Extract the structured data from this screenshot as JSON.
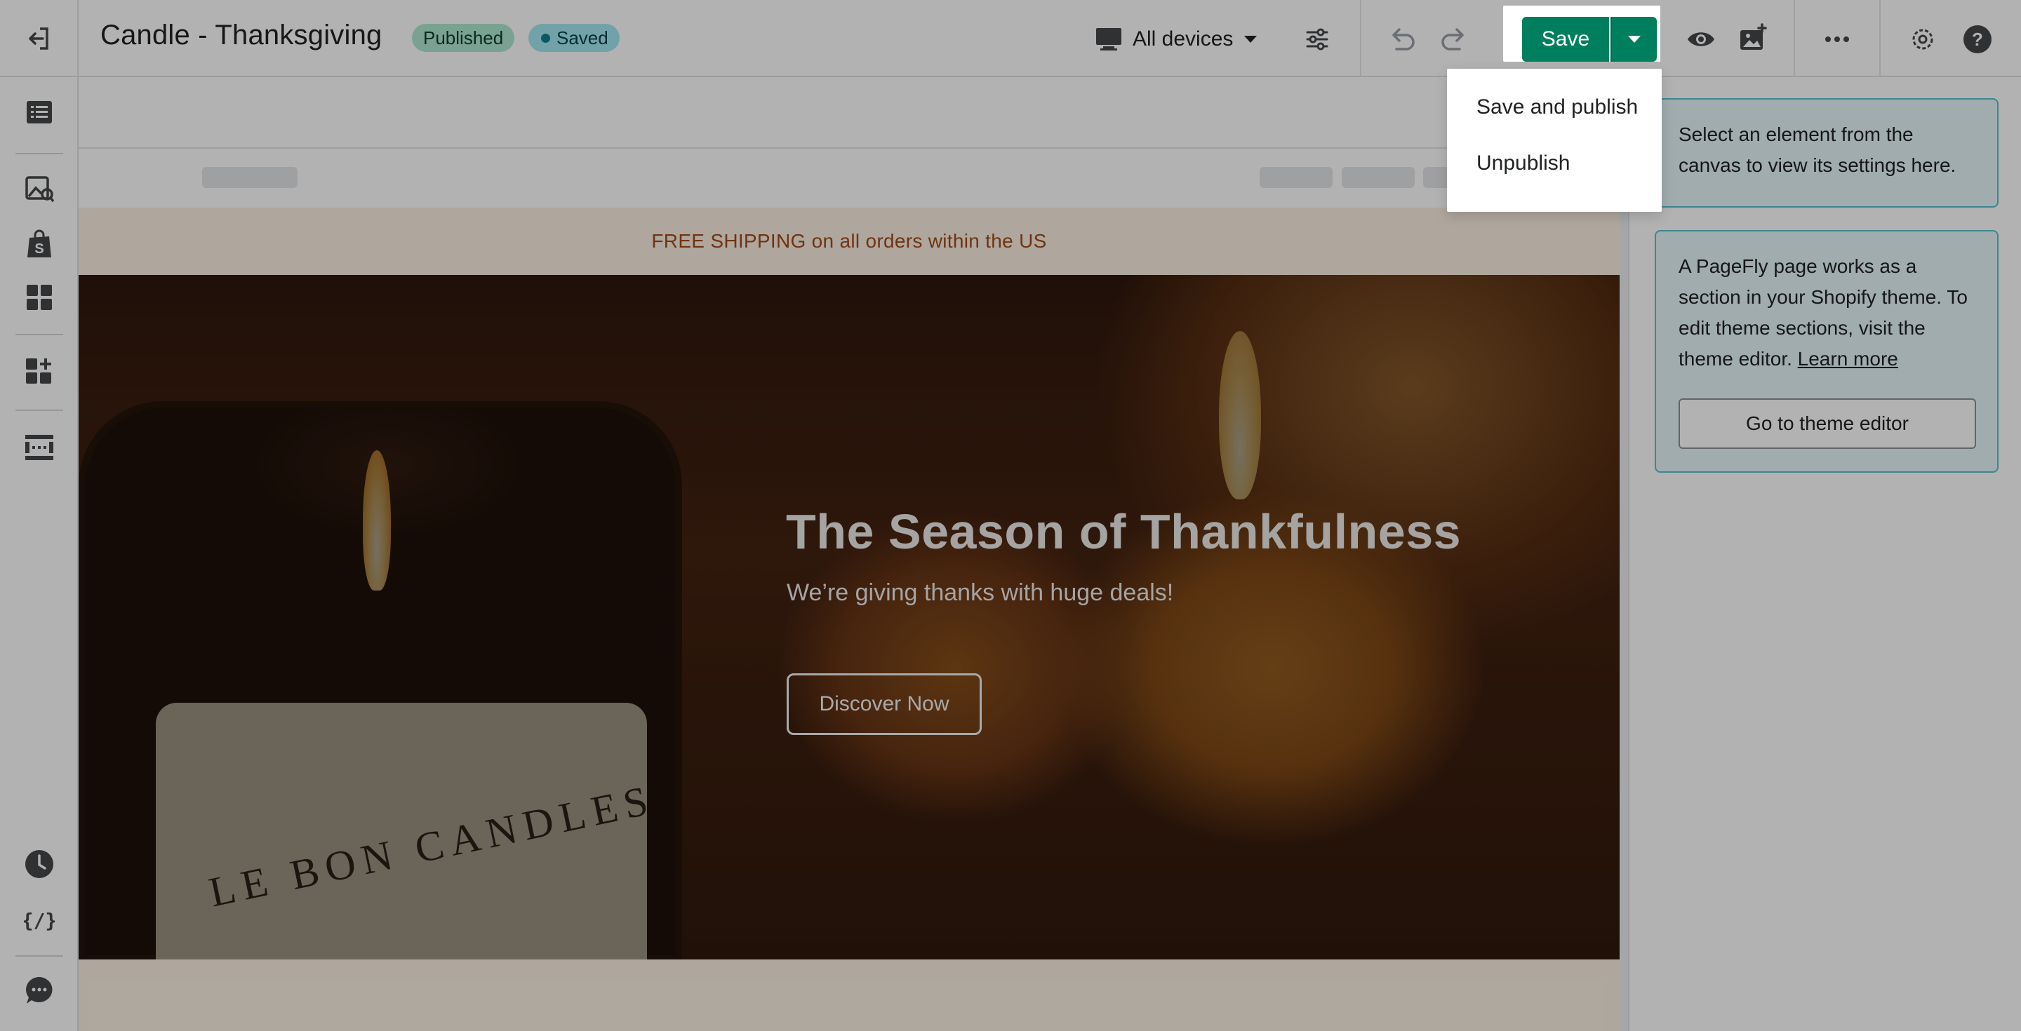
{
  "header": {
    "page_title": "Candle - Thanksgiving",
    "status_published": "Published",
    "status_saved": "Saved",
    "device_selector": "All devices",
    "save_label": "Save"
  },
  "icons": {
    "exit": "exit-icon",
    "desktop": "desktop-icon",
    "settings_sliders": "sliders-icon",
    "undo": "undo-icon",
    "redo": "redo-icon",
    "preview": "eye-icon",
    "publish_image": "image-upload-icon",
    "more": "more-horizontal-icon",
    "gear": "gear-icon",
    "help": "help-icon"
  },
  "save_menu": {
    "items": [
      "Save and publish",
      "Unpublish"
    ]
  },
  "left_rail": {
    "items": [
      "layers",
      "media",
      "shopify",
      "elements",
      "add-section",
      "sections"
    ],
    "bottom_items": [
      "history",
      "code",
      "chat"
    ]
  },
  "canvas": {
    "announcement": "FREE SHIPPING on all orders within the US",
    "hero": {
      "title": "The Season of Thankfulness",
      "subtitle": "We’re giving thanks with huge deals!",
      "button": "Discover Now",
      "image_text": "LE BON CANDLES"
    }
  },
  "right_panel": {
    "hint": "Select an element from the canvas to view its settings here.",
    "info_text": "A PageFly page works as a section in your Shopify theme. To edit theme sections, visit the theme editor.",
    "learn_more": "Learn more",
    "theme_editor_button": "Go to theme editor"
  },
  "colors": {
    "save_green": "#007f5f",
    "published_badge": "#aee9d1",
    "saved_badge": "#a4e8f2",
    "info_bg": "#e5f7f9",
    "info_border": "#5bc0cf"
  }
}
